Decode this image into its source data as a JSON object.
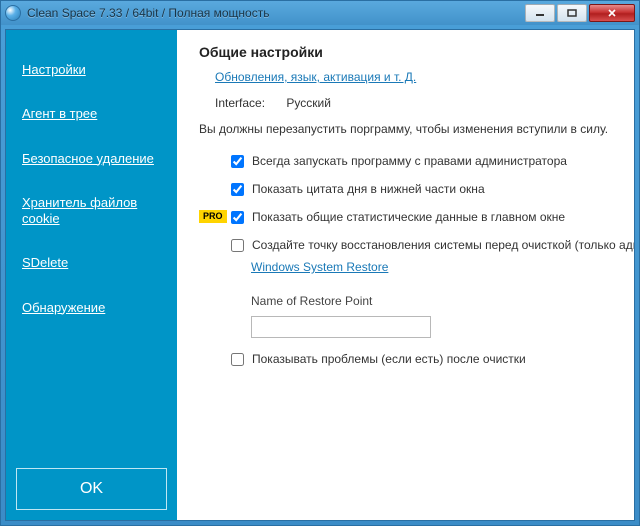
{
  "window": {
    "title": "Clean Space 7.33 / 64bit / Полная мощность"
  },
  "sidebar": {
    "items": [
      {
        "label": "Настройки"
      },
      {
        "label": "Агент в трее"
      },
      {
        "label": "Безопасное удаление"
      },
      {
        "label": "Хранитель файлов cookie"
      },
      {
        "label": "SDelete"
      },
      {
        "label": "Обнаружение"
      }
    ],
    "ok": "OK"
  },
  "main": {
    "heading": "Общие настройки",
    "updates_link": "Обновления, язык, активация и т. Д.",
    "interface_label": "Interface:",
    "interface_value": "Русский",
    "restart_note": "Вы должны перезапустить порграмму, чтобы изменения вступили в силу.",
    "opt_admin": "Всегда запускать программу с правами администратора",
    "opt_quote": "Показать цитата дня в нижней части окна",
    "opt_stats": "Показать общие статистические данные в главном окне",
    "pro_tag": "PRO",
    "opt_restore": "Создайте точку восстановления системы перед очисткой (только администраторы)",
    "restore_link": "Windows System Restore",
    "restore_name_label": "Name of Restore Point",
    "restore_name_value": "",
    "opt_problems": "Показывать проблемы (если есть) после очистки",
    "checks": {
      "admin": true,
      "quote": true,
      "stats": true,
      "restore": false,
      "problems": false
    }
  }
}
